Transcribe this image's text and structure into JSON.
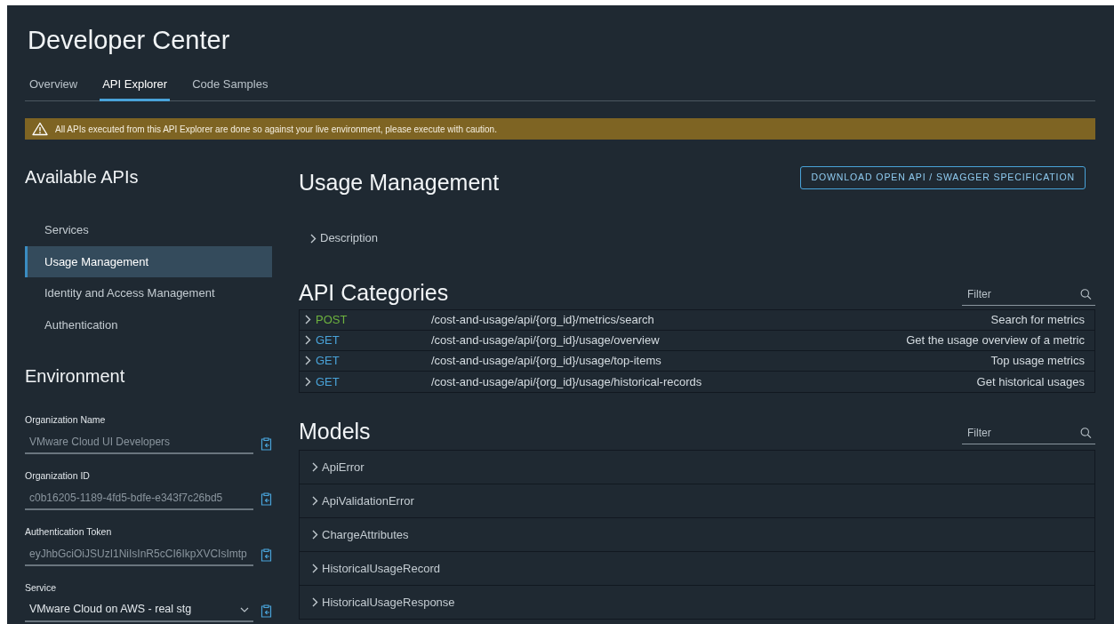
{
  "page": {
    "title": "Developer Center"
  },
  "tabs": [
    {
      "label": "Overview",
      "selected": false
    },
    {
      "label": "API Explorer",
      "selected": true
    },
    {
      "label": "Code Samples",
      "selected": false
    }
  ],
  "warning_banner": {
    "text": "All APIs executed from this API Explorer are done so against your live environment, please execute with caution."
  },
  "sidebar": {
    "title": "Available APIs",
    "items": [
      {
        "label": "Services",
        "selected": false
      },
      {
        "label": "Usage Management",
        "selected": true
      },
      {
        "label": "Identity and Access Management",
        "selected": false
      },
      {
        "label": "Authentication",
        "selected": false
      }
    ]
  },
  "environment": {
    "title": "Environment",
    "fields": [
      {
        "kind": "text",
        "label": "Organization Name",
        "value": "VMware Cloud UI Developers"
      },
      {
        "kind": "text",
        "label": "Organization ID",
        "value": "c0b16205-1189-4fd5-bdfe-e343f7c26bd5"
      },
      {
        "kind": "text",
        "label": "Authentication Token",
        "value": "eyJhbGciOiJSUzI1NiIsInR5cCI6IkpXVCIsImtp"
      },
      {
        "kind": "select",
        "label": "Service",
        "value": "VMware Cloud on AWS - real stg"
      }
    ]
  },
  "main": {
    "title": "Usage Management",
    "download_button": "DOWNLOAD OPEN API / SWAGGER SPECIFICATION",
    "description_toggle": "Description"
  },
  "api_categories": {
    "title": "API Categories",
    "filter": {
      "placeholder": "Filter"
    },
    "rows": [
      {
        "method": "POST",
        "color": "#6db33f",
        "path": "/cost-and-usage/api/{org_id}/metrics/search",
        "summary": "Search for metrics"
      },
      {
        "method": "GET",
        "color": "#49a3d9",
        "path": "/cost-and-usage/api/{org_id}/usage/overview",
        "summary": "Get the usage overview of a metric"
      },
      {
        "method": "GET",
        "color": "#49a3d9",
        "path": "/cost-and-usage/api/{org_id}/usage/top-items",
        "summary": "Top usage metrics"
      },
      {
        "method": "GET",
        "color": "#49a3d9",
        "path": "/cost-and-usage/api/{org_id}/usage/historical-records",
        "summary": "Get historical usages"
      }
    ]
  },
  "models": {
    "title": "Models",
    "filter": {
      "placeholder": "Filter"
    },
    "items": [
      "ApiError",
      "ApiValidationError",
      "ChargeAttributes",
      "HistoricalUsageRecord",
      "HistoricalUsageResponse"
    ]
  }
}
